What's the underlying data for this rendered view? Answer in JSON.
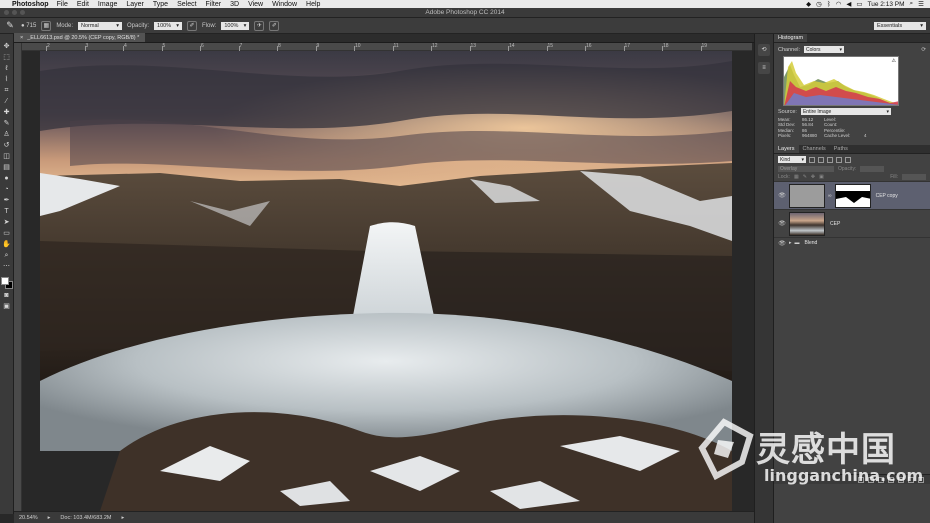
{
  "menubar": {
    "app": "Photoshop",
    "items": [
      "File",
      "Edit",
      "Image",
      "Layer",
      "Type",
      "Select",
      "Filter",
      "3D",
      "View",
      "Window",
      "Help"
    ],
    "clock": "Tue 2:13 PM"
  },
  "window": {
    "title": "Adobe Photoshop CC 2014"
  },
  "options": {
    "brush_size": "715",
    "mode_label": "Mode:",
    "mode_value": "Normal",
    "opacity_label": "Opacity:",
    "opacity_value": "100%",
    "flow_label": "Flow:",
    "flow_value": "100%",
    "workspace": "Essentials"
  },
  "document": {
    "tab_label": "_ELL6613.psd @ 20.5% (CEP copy, RGB/8) *",
    "ruler_ticks": [
      "2",
      "3",
      "4",
      "5",
      "6",
      "7",
      "8",
      "9",
      "10",
      "11",
      "12",
      "13",
      "14",
      "15",
      "16",
      "17",
      "18",
      "19"
    ]
  },
  "status": {
    "zoom": "20.54%",
    "doc": "Doc: 103.4M/683.2M"
  },
  "histogram": {
    "tab": "Histogram",
    "channel_label": "Channel:",
    "channel_value": "Colors",
    "source_label": "Source:",
    "source_value": "Entire Image",
    "stats": [
      [
        "Mean:",
        "86.12",
        "Level:",
        ""
      ],
      [
        "Std Dev:",
        "56.84",
        "Count:",
        ""
      ],
      [
        "Median:",
        "86",
        "Percentile:",
        ""
      ],
      [
        "Pixels:",
        "964880",
        "Cache Level:",
        "4"
      ]
    ]
  },
  "layers": {
    "tabs": [
      "Layers",
      "Channels",
      "Paths"
    ],
    "kind_label": "Kind",
    "blend_value": "Overlay",
    "opacity_label": "Opacity:",
    "lock_label": "Lock:",
    "fill_label": "Fill:",
    "items": [
      {
        "name": "CEP copy",
        "selected": true,
        "has_mask": true
      },
      {
        "name": "CEP",
        "selected": false,
        "has_mask": false
      },
      {
        "name": "Blend",
        "selected": false,
        "is_group": true
      }
    ]
  },
  "watermark": {
    "cn": "灵感中国",
    "en": "lingganchina.com"
  },
  "colors": {
    "accent_selected_layer": "#5d6070",
    "panel_bg": "#424242"
  }
}
